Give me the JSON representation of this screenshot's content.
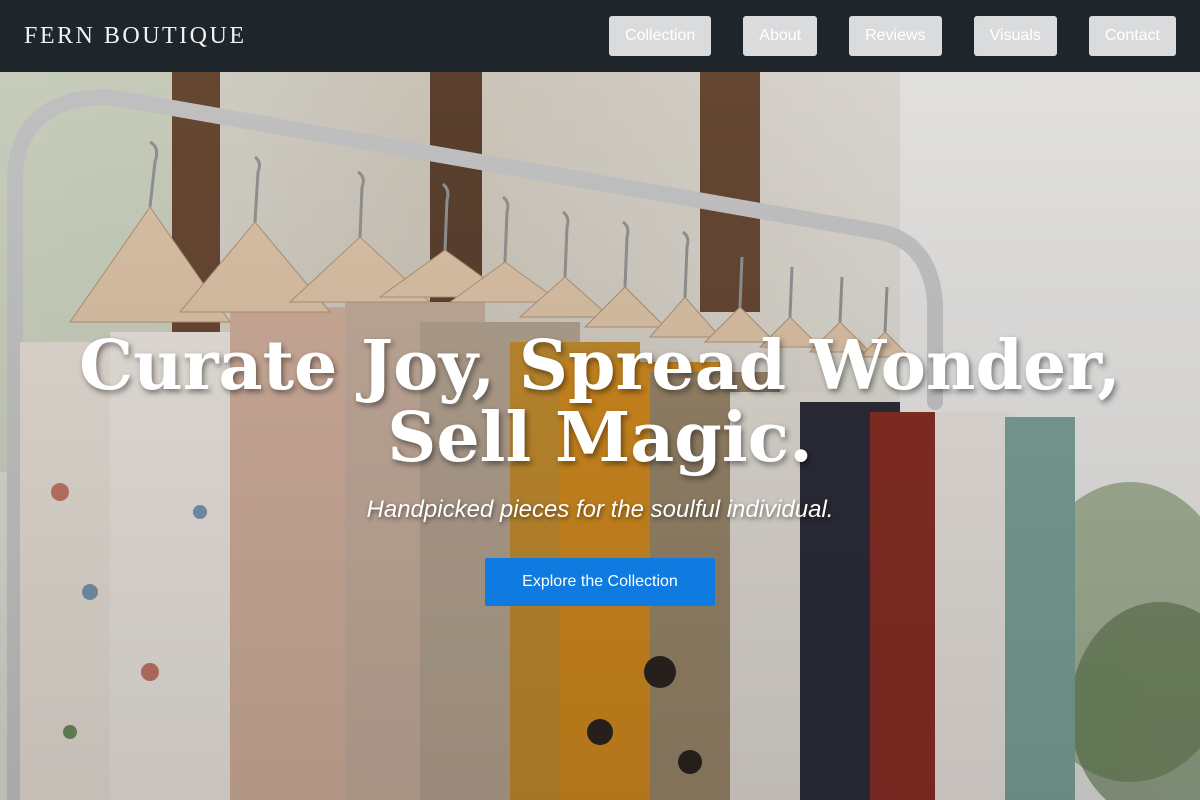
{
  "brand": {
    "name": "FERN BOUTIQUE"
  },
  "nav": {
    "items": [
      {
        "label": "Collection"
      },
      {
        "label": "About"
      },
      {
        "label": "Reviews"
      },
      {
        "label": "Visuals"
      },
      {
        "label": "Contact"
      }
    ]
  },
  "hero": {
    "title": "Curate Joy, Spread Wonder, Sell Magic.",
    "subtitle": "Handpicked pieces for the soulful individual.",
    "cta_label": "Explore the Collection",
    "image_subject": "clothing rack with shirts on wooden hangers"
  },
  "colors": {
    "navbar_bg": "#1f262b",
    "nav_button_bg": "#dadbdc",
    "cta_bg": "#0f7be0",
    "text_light": "#ffffff"
  }
}
